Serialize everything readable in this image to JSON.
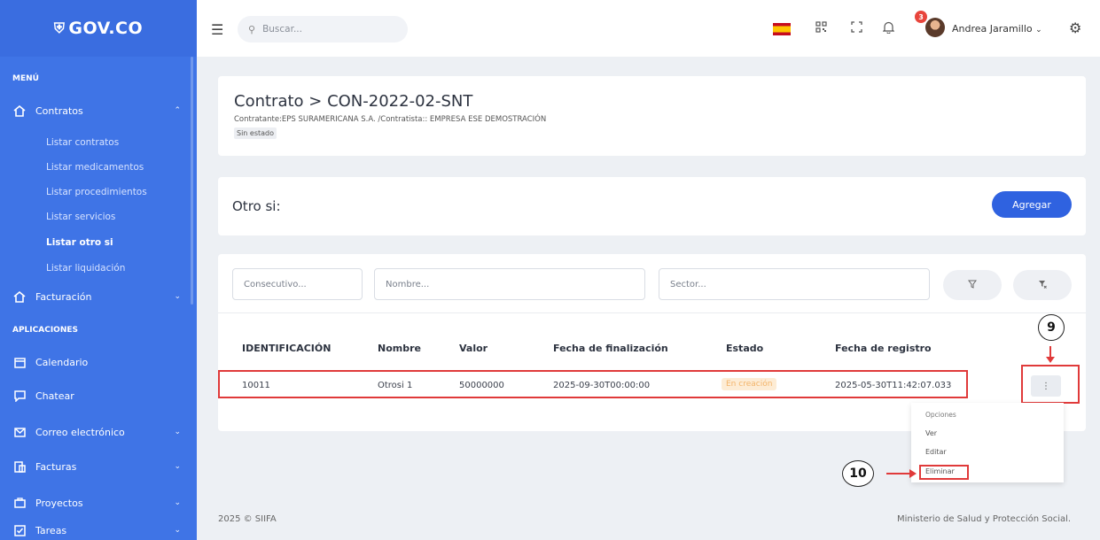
{
  "brand": {
    "logo_text": "GOV.CO",
    "logo_mark": "⛨"
  },
  "sidebar": {
    "menu_header": "MENÚ",
    "contratos_label": "Contratos",
    "sub_items": [
      {
        "label": "Listar contratos"
      },
      {
        "label": "Listar medicamentos"
      },
      {
        "label": "Listar procedimientos"
      },
      {
        "label": "Listar servicios"
      },
      {
        "label": "Listar otro si"
      },
      {
        "label": "Listar liquidación"
      }
    ],
    "facturacion_label": "Facturación",
    "apps_header": "APLICACIONES",
    "apps": [
      {
        "label": "Calendario"
      },
      {
        "label": "Chatear"
      },
      {
        "label": "Correo electrónico"
      },
      {
        "label": "Facturas"
      },
      {
        "label": "Proyectos"
      },
      {
        "label": "Tareas"
      }
    ]
  },
  "topbar": {
    "search_placeholder": "Buscar...",
    "notification_count": "3",
    "user_name": "Andrea Jaramillo"
  },
  "contract": {
    "title": "Contrato > CON-2022-02-SNT",
    "subtitle": "Contratante:EPS SURAMERICANA S.A. /Contratista:: EMPRESA ESE DEMOSTRACIÓN",
    "status": "Sin estado"
  },
  "otrosi": {
    "title": "Otro si:",
    "add_label": "Agregar"
  },
  "filters": {
    "consecutivo": "Consecutivo...",
    "nombre": "Nombre...",
    "sector": "Sector..."
  },
  "table": {
    "headers": [
      "IDENTIFICACIÓN",
      "Nombre",
      "Valor",
      "Fecha de finalización",
      "Estado",
      "Fecha de registro"
    ],
    "row": [
      "10011",
      "Otrosi 1",
      "50000000",
      "2025-09-30T00:00:00",
      "En creación",
      "2025-05-30T11:42:07.033"
    ]
  },
  "actions": {
    "dots": "⋮",
    "menu": {
      "header": "Opciones",
      "ver": "Ver",
      "editar": "Editar",
      "eliminar": "Eliminar"
    }
  },
  "annotations": {
    "step9": "9",
    "step10": "10"
  },
  "footer": {
    "left": "2025 © SIIFA",
    "right": "Ministerio de Salud y Protección Social."
  },
  "colors": {
    "sidebar": "#3f74e6",
    "primary_button": "#2f62e0",
    "annotation_red": "#e03a3a",
    "status_pill": "#fdecd5"
  }
}
